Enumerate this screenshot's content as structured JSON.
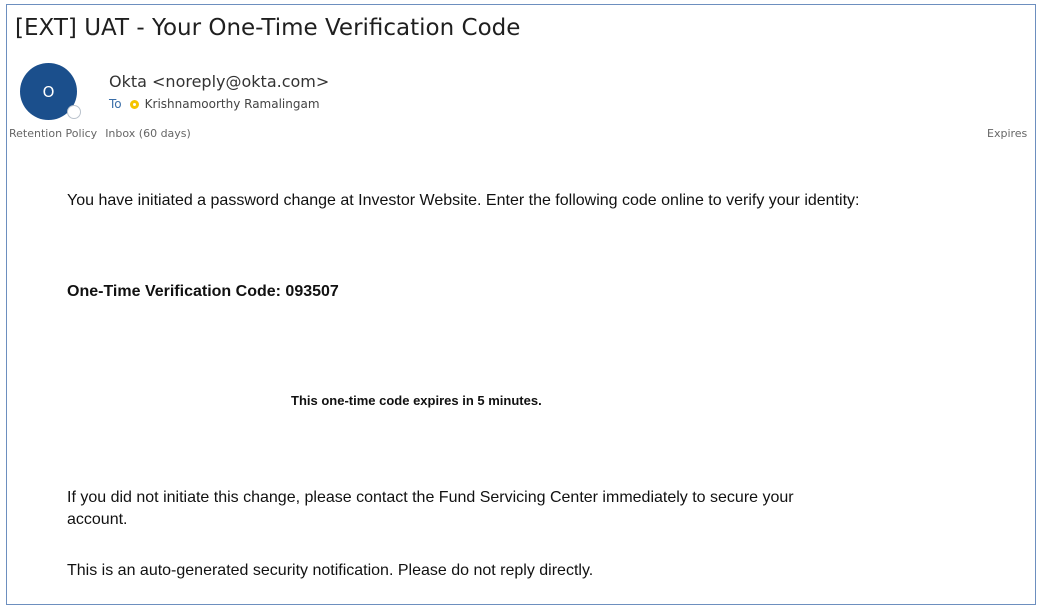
{
  "email": {
    "subject": "[EXT] UAT - Your One-Time Verification Code",
    "avatar_initial": "O",
    "sender": "Okta <noreply@okta.com>",
    "to_label": "To",
    "recipient": "Krishnamoorthy Ramalingam",
    "retention_policy": "Retention Policy",
    "retention_folder": "Inbox (60 days)",
    "expires_label": "Expires"
  },
  "body": {
    "intro": "You have initiated a password change at Investor Website. Enter the following code online to verify your identity:",
    "code_line": "One-Time Verification Code: 093507",
    "expiry_notice": "This one-time code expires in 5 minutes.",
    "contact_notice": "If you did not initiate this change, please contact the Fund Servicing Center immediately to secure your account.",
    "auto_notice": "This is an auto-generated security notification. Please do not reply directly."
  },
  "icons": {
    "avatar": "avatar-icon",
    "presence": "presence-status-icon"
  },
  "colors": {
    "frame_border": "#6d8fbf",
    "avatar_bg": "#1b4f8c",
    "presence": "#f5c400"
  }
}
